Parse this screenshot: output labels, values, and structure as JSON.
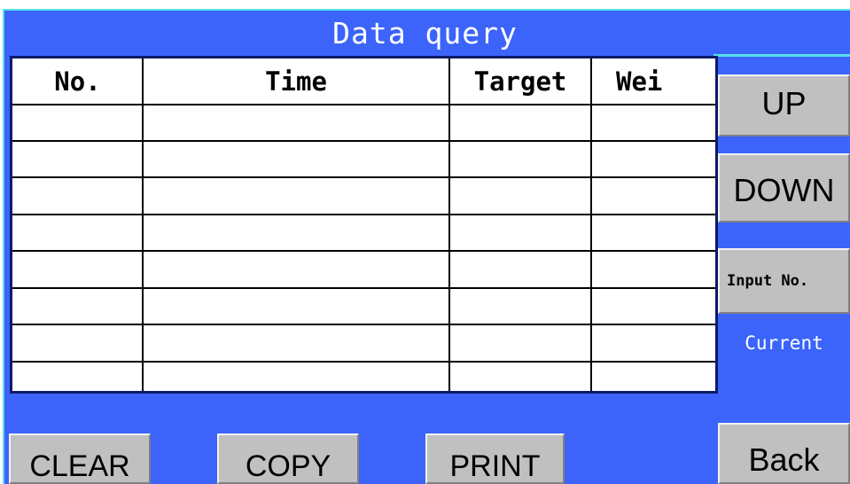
{
  "header": {
    "title": "Data query"
  },
  "table": {
    "columns": [
      "No.",
      "Time",
      "Target",
      "Wei"
    ],
    "rows": [
      [
        "",
        "",
        "",
        ""
      ],
      [
        "",
        "",
        "",
        ""
      ],
      [
        "",
        "",
        "",
        ""
      ],
      [
        "",
        "",
        "",
        ""
      ],
      [
        "",
        "",
        "",
        ""
      ],
      [
        "",
        "",
        "",
        ""
      ],
      [
        "",
        "",
        "",
        ""
      ],
      [
        "",
        "",
        "",
        ""
      ]
    ]
  },
  "side": {
    "up_label": "UP",
    "down_label": "DOWN",
    "input_label": "Input No.",
    "current_label": "Current",
    "back_label": "Back"
  },
  "footer": {
    "clear_label": "CLEAR",
    "copy_label": "COPY",
    "print_label": "PRINT"
  },
  "colors": {
    "panel_blue": "#3c64fa",
    "accent_cyan": "#58e0e8",
    "table_border": "#0c1a66",
    "button_gray": "#c0c0c0"
  }
}
